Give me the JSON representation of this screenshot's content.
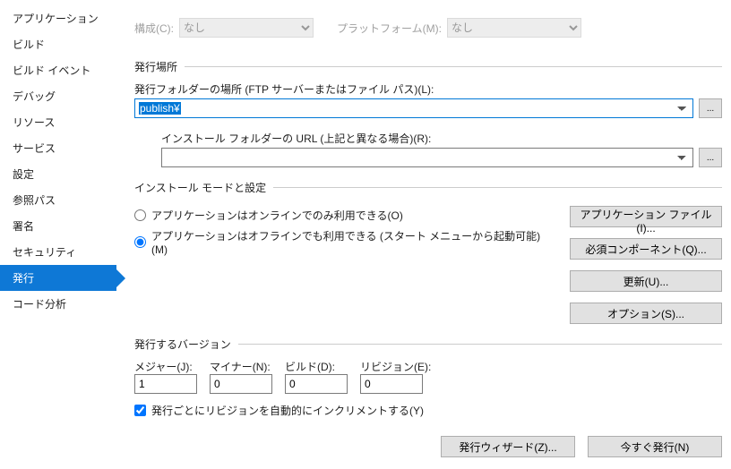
{
  "sidebar": {
    "items": [
      {
        "label": "アプリケーション"
      },
      {
        "label": "ビルド"
      },
      {
        "label": "ビルド イベント"
      },
      {
        "label": "デバッグ"
      },
      {
        "label": "リソース"
      },
      {
        "label": "サービス"
      },
      {
        "label": "設定"
      },
      {
        "label": "参照パス"
      },
      {
        "label": "署名"
      },
      {
        "label": "セキュリティ"
      },
      {
        "label": "発行"
      },
      {
        "label": "コード分析"
      }
    ],
    "selected_index": 10
  },
  "top": {
    "config_label": "構成(C):",
    "config_value": "なし",
    "platform_label": "プラットフォーム(M):",
    "platform_value": "なし"
  },
  "publish_location": {
    "title": "発行場所",
    "folder_label": "発行フォルダーの場所 (FTP サーバーまたはファイル パス)(L):",
    "folder_value": "publish¥",
    "install_url_label": "インストール フォルダーの URL (上記と異なる場合)(R):",
    "install_url_value": "",
    "browse": "..."
  },
  "install_mode": {
    "title": "インストール モードと設定",
    "radio_online": "アプリケーションはオンラインでのみ利用できる(O)",
    "radio_offline": "アプリケーションはオフラインでも利用できる (スタート メニューから起動可能)(M)",
    "selected": "offline",
    "btn_files": "アプリケーション ファイル(I)...",
    "btn_prereq": "必須コンポーネント(Q)...",
    "btn_updates": "更新(U)...",
    "btn_options": "オプション(S)..."
  },
  "publish_version": {
    "title": "発行するバージョン",
    "major_label": "メジャー(J):",
    "minor_label": "マイナー(N):",
    "build_label": "ビルド(D):",
    "revision_label": "リビジョン(E):",
    "major": "1",
    "minor": "0",
    "build": "0",
    "revision": "0",
    "auto_increment": "発行ごとにリビジョンを自動的にインクリメントする(Y)",
    "auto_increment_checked": true
  },
  "bottom": {
    "wizard": "発行ウィザード(Z)...",
    "publish_now": "今すぐ発行(N)"
  }
}
